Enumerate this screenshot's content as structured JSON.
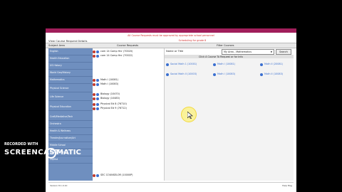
{
  "notice": {
    "line1": "All Course Requests must be approved by appropriate school personnel",
    "line2": "Scheduling for grade 8"
  },
  "page": {
    "view_title": "View Course Request Details",
    "col_subject_area": "Subject Area",
    "col_course_requests": "Course Requests",
    "col_filter_courses": "Filter Courses"
  },
  "sidebar": {
    "items": [
      {
        "label": "English"
      },
      {
        "label": "Health Education"
      },
      {
        "label": "US History"
      },
      {
        "label": "World Geo/History"
      },
      {
        "label": "Mathematics"
      },
      {
        "label": "Physical Science"
      },
      {
        "label": "Life Science"
      },
      {
        "label": "Physical Education"
      },
      {
        "label": "Craft/Medialive/Tech"
      },
      {
        "label": "Orchestra"
      },
      {
        "label": "Health & Wellness"
      },
      {
        "label": "Theatre/Journalism/Art"
      },
      {
        "label": "Middle School"
      },
      {
        "label": "RCCI Courses"
      },
      {
        "label": "Lit/Hist"
      }
    ]
  },
  "requests": [
    {
      "text": "com 14 Comp Hnr (70020)"
    },
    {
      "text": "com 14 Comp Hnr (70022)"
    },
    {
      "text": "Math I (10081)"
    },
    {
      "text": "Math I (10083)"
    },
    {
      "text": "Biology (10470)"
    },
    {
      "text": "Biology (10483)"
    },
    {
      "text": "Physical Ed 8 (76710)"
    },
    {
      "text": "Physical Ed 9 (76712)"
    },
    {
      "text": "SEC COUNSELOR (10000P)"
    }
  ],
  "filter": {
    "name_label": "Name or Title",
    "area_value": "My Area - Mathematics",
    "search_label": "Search",
    "instruction": "Click A Course To Request or   for Info",
    "results": [
      {
        "text": "Social Math 1 (10001)"
      },
      {
        "text": "Math I (10081)"
      },
      {
        "text": "Math II (20081)"
      },
      {
        "text": "Social Math II (10003)"
      },
      {
        "text": "Math I (10083)"
      },
      {
        "text": "Math II (10083)"
      }
    ]
  },
  "footer": {
    "left": "Version 8.1.0.10",
    "right": "Help Msg"
  },
  "watermark": {
    "line1": "RECORDED WITH",
    "brand_left": "SCREENCAST",
    "brand_right": "MATIC"
  },
  "colors": {
    "topbar": "#a01e5a",
    "sidebar": "#6f8fbf",
    "notice": "#d0302e",
    "link": "#3a6fd0"
  }
}
